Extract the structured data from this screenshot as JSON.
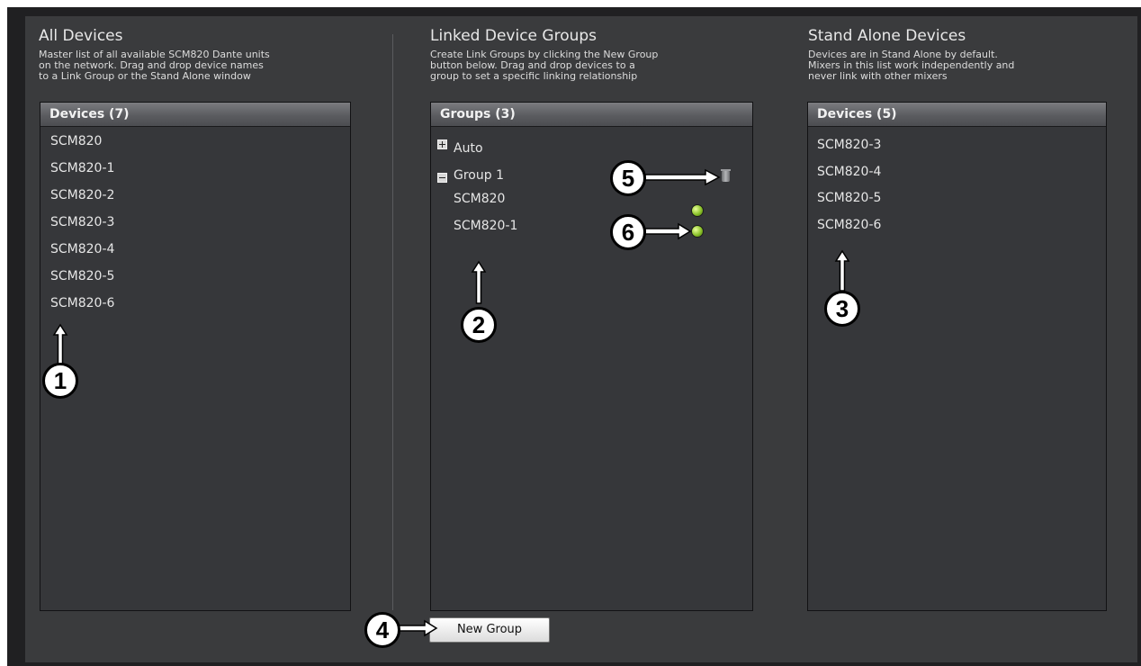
{
  "all_devices": {
    "title": "All Devices",
    "desc": [
      "Master list of all available SCM820 Dante units",
      "on the network. Drag and drop device names",
      "to a Link Group or the Stand Alone window"
    ],
    "header": "Devices (7)",
    "items": [
      "SCM820",
      "SCM820-1",
      "SCM820-2",
      "SCM820-3",
      "SCM820-4",
      "SCM820-5",
      "SCM820-6"
    ]
  },
  "linked_groups": {
    "title": "Linked Device Groups",
    "desc": [
      "Create Link Groups by clicking the New Group",
      "button below. Drag and drop devices to a",
      "group to set a specific linking relationship"
    ],
    "header": "Groups (3)",
    "groups": [
      {
        "label": "Auto",
        "expanded": false,
        "members": []
      },
      {
        "label": "Group 1",
        "expanded": true,
        "members": [
          "SCM820",
          "SCM820-1"
        ]
      }
    ]
  },
  "stand_alone": {
    "title": "Stand Alone Devices",
    "desc": [
      "Devices are in Stand Alone by default.",
      "Mixers in this list work independently and",
      "never link with other mixers"
    ],
    "header": "Devices (5)",
    "items": [
      "SCM820-3",
      "SCM820-4",
      "SCM820-5",
      "SCM820-6"
    ]
  },
  "new_group_button": "New Group",
  "callouts": [
    "1",
    "2",
    "3",
    "4",
    "5",
    "6"
  ],
  "icons": {
    "group_collapsed": "plus-box-icon",
    "group_expanded": "minus-box-icon",
    "delete": "trash-icon",
    "status": "green-led-icon"
  },
  "colors": {
    "led": "#8bc22a",
    "background": "#3a3b3d",
    "panel": "#36373a"
  }
}
